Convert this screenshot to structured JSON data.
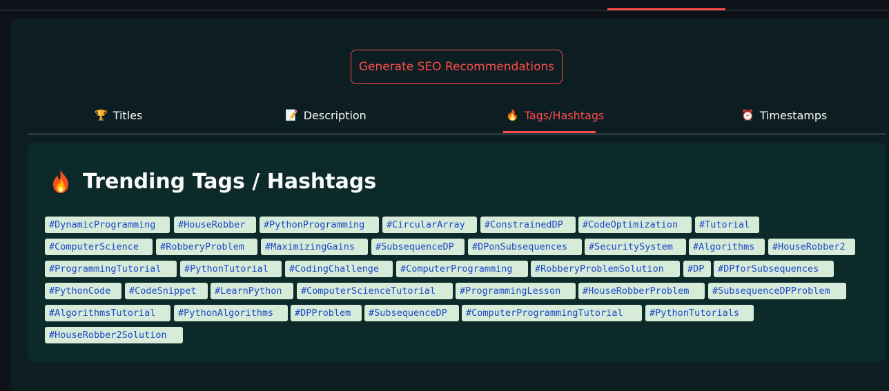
{
  "button": {
    "generate_label": "Generate SEO Recommendations"
  },
  "tabs": [
    {
      "label": "Titles",
      "icon": "trophy-icon",
      "glyph": "🏆",
      "active": false
    },
    {
      "label": "Description",
      "icon": "memo-icon",
      "glyph": "📝",
      "active": false
    },
    {
      "label": "Tags/Hashtags",
      "icon": "fire-icon",
      "glyph": "🔥",
      "active": true
    },
    {
      "label": "Timestamps",
      "icon": "alarm-clock-icon",
      "glyph": "⏰",
      "active": false
    }
  ],
  "card": {
    "heading": "Trending Tags / Hashtags",
    "heading_icon": "fire-icon"
  },
  "tags": [
    "#DynamicProgramming",
    "#HouseRobber",
    "#PythonProgramming",
    "#CircularArray",
    "#ConstrainedDP",
    "#CodeOptimization",
    "#Tutorial",
    "#ComputerScience",
    "#RobberyProblem",
    "#MaximizingGains",
    "#SubsequenceDP",
    "#DPonSubsequences",
    "#SecuritySystem",
    "#Algorithms",
    "#HouseRobber2",
    "#ProgrammingTutorial",
    "#PythonTutorial",
    "#CodingChallenge",
    "#ComputerProgramming",
    "#RobberyProblemSolution",
    "#DP",
    "#DPforSubsequences",
    "#PythonCode",
    "#CodeSnippet",
    "#LearnPython",
    "#ComputerScienceTutorial",
    "#ProgrammingLesson",
    "#HouseRobberProblem",
    "#SubsequenceDPProblem",
    "#AlgorithmsTutorial",
    "#PythonAlgorithms",
    "#DPProblem",
    "#SubsequenceDP",
    "#ComputerProgrammingTutorial",
    "#PythonTutorials",
    "#HouseRobber2Solution"
  ],
  "colors": {
    "accent": "#ff4b4b",
    "tag_background": "#d6ecd9",
    "tag_text": "#1d47c9",
    "card_background": "#0d2a2b"
  }
}
